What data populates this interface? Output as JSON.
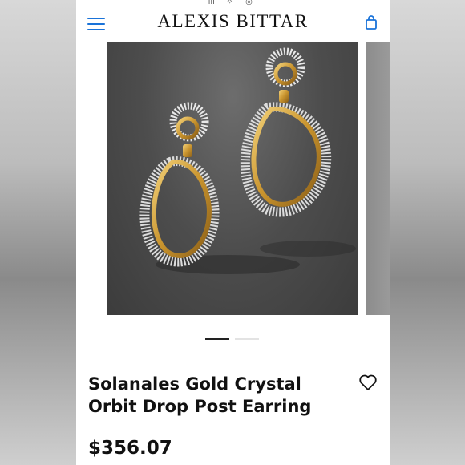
{
  "header": {
    "brand": "ALEXIS BITTAR",
    "decor": "ᗰ ✧ ◎",
    "menu_icon": "hamburger-menu-icon",
    "bag_icon": "shopping-bag-icon"
  },
  "product": {
    "title": "Solanales Gold Crystal Orbit Drop Post Earring",
    "price": "$356.07",
    "wishlist_icon": "heart-icon"
  },
  "carousel": {
    "slide_count": 2,
    "active_index": 0
  },
  "colors": {
    "accent": "#1a73d9",
    "gold": "#d9a736",
    "text": "#111111"
  }
}
